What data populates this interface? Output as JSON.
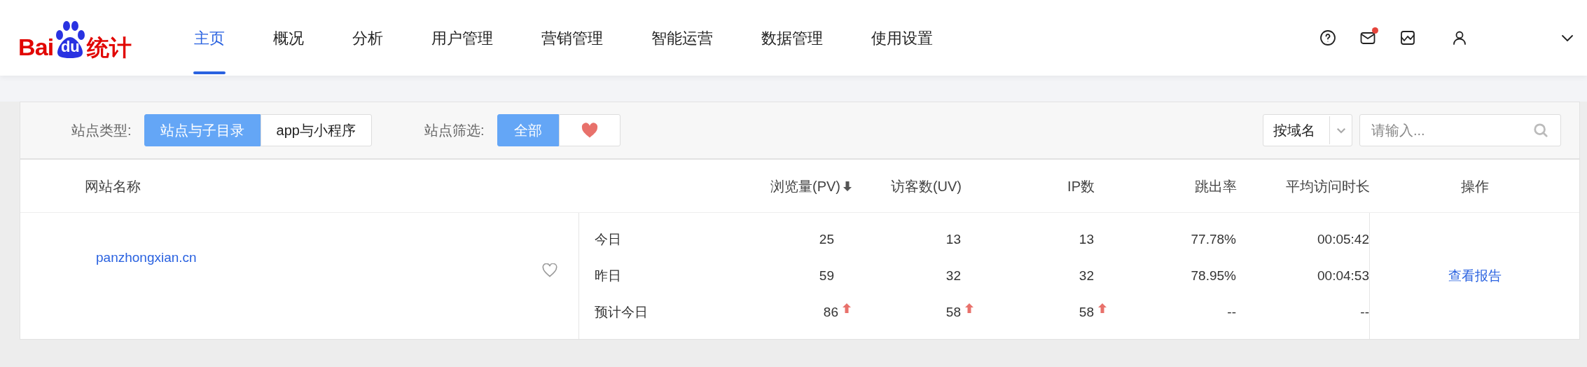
{
  "logo": {
    "left": "Bai",
    "paw": "du",
    "right": "统计"
  },
  "nav": [
    {
      "label": "主页",
      "selected": true
    },
    {
      "label": "概况",
      "selected": false
    },
    {
      "label": "分析",
      "selected": false
    },
    {
      "label": "用户管理",
      "selected": false
    },
    {
      "label": "营销管理",
      "selected": false
    },
    {
      "label": "智能运营",
      "selected": false
    },
    {
      "label": "数据管理",
      "selected": false
    },
    {
      "label": "使用设置",
      "selected": false
    }
  ],
  "header_icons": [
    {
      "kind": "help",
      "badge": false
    },
    {
      "kind": "mail",
      "badge": true
    },
    {
      "kind": "chart",
      "badge": false
    },
    {
      "kind": "user",
      "badge": false
    },
    {
      "kind": "chevron",
      "badge": false
    }
  ],
  "filters": {
    "type_label": "站点类型:",
    "type_options": [
      {
        "label": "站点与子目录",
        "selected": true
      },
      {
        "label": "app与小程序",
        "selected": false
      }
    ],
    "filter_label": "站点筛选:",
    "filter_options": [
      {
        "kind": "text",
        "label": "全部",
        "selected": true
      },
      {
        "kind": "heart",
        "selected": false
      }
    ],
    "domain_select": {
      "value": "按域名"
    },
    "search": {
      "placeholder": "请输入..."
    }
  },
  "table": {
    "columns": [
      {
        "label": "网站名称",
        "sorted": false
      },
      {
        "label": "浏览量(PV)",
        "sorted": true
      },
      {
        "label": "访客数(UV)",
        "sorted": false
      },
      {
        "label": "IP数",
        "sorted": false
      },
      {
        "label": "跳出率",
        "sorted": false
      },
      {
        "label": "平均访问时长",
        "sorted": false
      },
      {
        "label": "操作",
        "sorted": false
      }
    ],
    "sites": [
      {
        "name": "panzhongxian.cn",
        "favorite": false,
        "action": "查看报告",
        "rows": [
          {
            "label": "今日",
            "cells": [
              {
                "text": "25",
                "rising": false
              },
              {
                "text": "13",
                "rising": false
              },
              {
                "text": "13",
                "rising": false
              },
              {
                "text": "77.78%",
                "rising": false
              },
              {
                "text": "00:05:42",
                "rising": false
              }
            ]
          },
          {
            "label": "昨日",
            "cells": [
              {
                "text": "59",
                "rising": false
              },
              {
                "text": "32",
                "rising": false
              },
              {
                "text": "32",
                "rising": false
              },
              {
                "text": "78.95%",
                "rising": false
              },
              {
                "text": "00:04:53",
                "rising": false
              }
            ]
          },
          {
            "label": "预计今日",
            "cells": [
              {
                "text": "86",
                "rising": true
              },
              {
                "text": "58",
                "rising": true
              },
              {
                "text": "58",
                "rising": true
              },
              {
                "text": "--",
                "rising": false
              },
              {
                "text": "--",
                "rising": false
              }
            ]
          }
        ]
      }
    ]
  }
}
